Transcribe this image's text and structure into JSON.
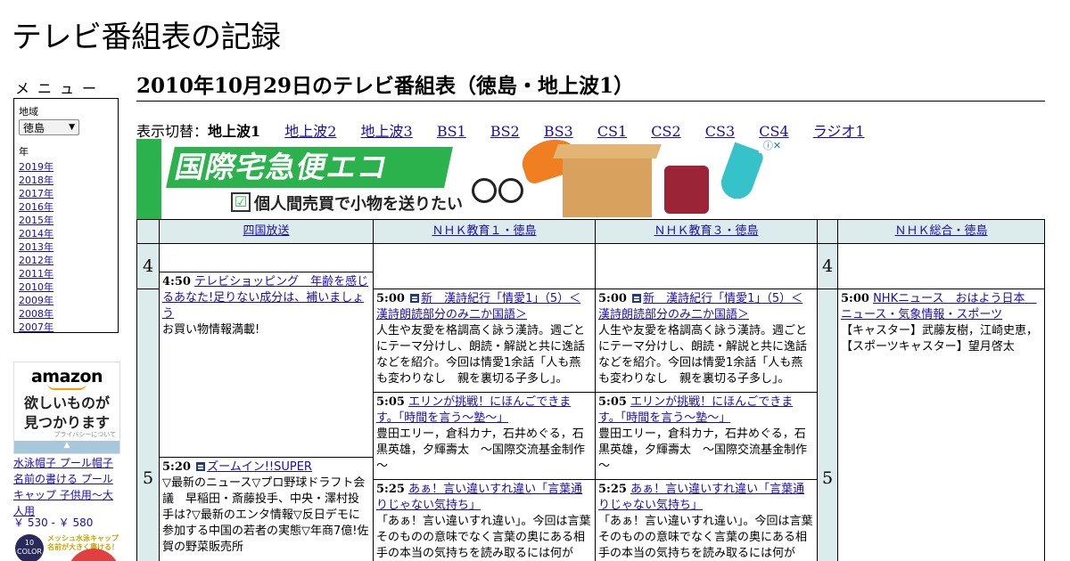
{
  "site": {
    "title": "テレビ番組表の記録"
  },
  "sidebar": {
    "menu_heading": "メニュー",
    "region_label": "地域",
    "region_value": "徳島",
    "year_label": "年",
    "years": [
      "2019年",
      "2018年",
      "2017年",
      "2016年",
      "2015年",
      "2014年",
      "2013年",
      "2012年",
      "2011年",
      "2010年",
      "2009年",
      "2008年",
      "2007年"
    ]
  },
  "ad_side": {
    "brand": "amazon",
    "tagline1": "欲しいものが",
    "tagline2": "見つかります",
    "privacy": "プライバシーについて",
    "product_link": "水泳帽子 プール帽子 名前の書ける プールキャップ 子供用～大人用",
    "price": "￥ 530 - ￥ 580",
    "badge": "10 COLOR",
    "promo": "メッシュ水泳キャップ 名前が大きく書ける！"
  },
  "main": {
    "heading": "2010年10月29日のテレビ番組表（徳島・地上波1）",
    "switch_label": "表示切替：",
    "switch_current": "地上波1",
    "switch_items": [
      "地上波2",
      "地上波3",
      "BS1",
      "BS2",
      "BS3",
      "CS1",
      "CS2",
      "CS3",
      "CS4",
      "ラジオ1"
    ]
  },
  "ad_banner": {
    "headline": "国際宅急便エコ",
    "sub": "個人間売買で小物を送りたい",
    "check": "☑",
    "adchoice": "ⓘ✕"
  },
  "schedule": {
    "channels": [
      "四国放送",
      "ＮＨＫ教育１・徳島",
      "ＮＨＫ教育３・徳島",
      "ＮＨＫ総合・徳島"
    ],
    "hours": [
      "4",
      "5"
    ],
    "programs": {
      "ch0_a": {
        "time": "4:50",
        "title": "テレビショッピング　年齢を感じるあなた!足りない成分は、補いましょう",
        "desc": "お買い物情報満載!"
      },
      "ch0_b": {
        "time": "5:20",
        "title": "ズームイン!!SUPER",
        "desc": "▽最新のニュース▽プロ野球ドラフト会議　早稲田・斎藤投手、中央・澤村投手は?▽最新のエンタ情報▽反日デモに参加する中国の若者の実態▽年商7億!佐賀の野菜販売所"
      },
      "ch1_a": {
        "time": "5:00",
        "title": "新　漢詩紀行「情愛1」（5）＜漢詩朗読部分のみ二か国語＞",
        "desc": "人生や友愛を格調高く詠う漢詩。週ごとにテーマ分けし、朗読・解説と共に逸話などを紹介。今回は情愛1余話「人も燕も変わりなし　親を裏切る子多し」。"
      },
      "ch1_b": {
        "time": "5:05",
        "title": "エリンが挑戦！にほんごできます。「時間を言う～塾～」",
        "desc": "豊田エリー，倉科カナ，石井めぐる，石黒英雄，夕輝壽太　～国際交流基金制作～"
      },
      "ch1_c": {
        "time": "5:25",
        "title": "あぁ！言い違いすれ違い「言葉通りじゃない気持ち」",
        "desc": "「あぁ！言い違いすれ違い」。今回は言葉そのものの意味でなく言葉の奥にある相手の本当の気持ちを読み取るには何が"
      },
      "ch2_a": {
        "time": "5:00",
        "title": "新　漢詩紀行「情愛1」（5）＜漢詩朗読部分のみ二か国語＞",
        "desc": "人生や友愛を格調高く詠う漢詩。週ごとにテーマ分けし、朗読・解説と共に逸話などを紹介。今回は情愛1余話「人も燕も変わりなし　親を裏切る子多し」。"
      },
      "ch2_b": {
        "time": "5:05",
        "title": "エリンが挑戦！にほんごできます。「時間を言う～塾～」",
        "desc": "豊田エリー，倉科カナ，石井めぐる，石黒英雄，夕輝壽太　～国際交流基金制作～"
      },
      "ch2_c": {
        "time": "5:25",
        "title": "あぁ！言い違いすれ違い「言葉通りじゃない気持ち」",
        "desc": "「あぁ！言い違いすれ違い」。今回は言葉そのものの意味でなく言葉の奥にある相手の本当の気持ちを読み取るには何が"
      },
      "ch3_a": {
        "time": "5:00",
        "title": "NHKニュース　おはよう日本　ニュース・気象情報・スポーツ",
        "desc": "【キャスター】武藤友樹，江崎史恵，【スポーツキャスター】望月啓太"
      }
    }
  }
}
